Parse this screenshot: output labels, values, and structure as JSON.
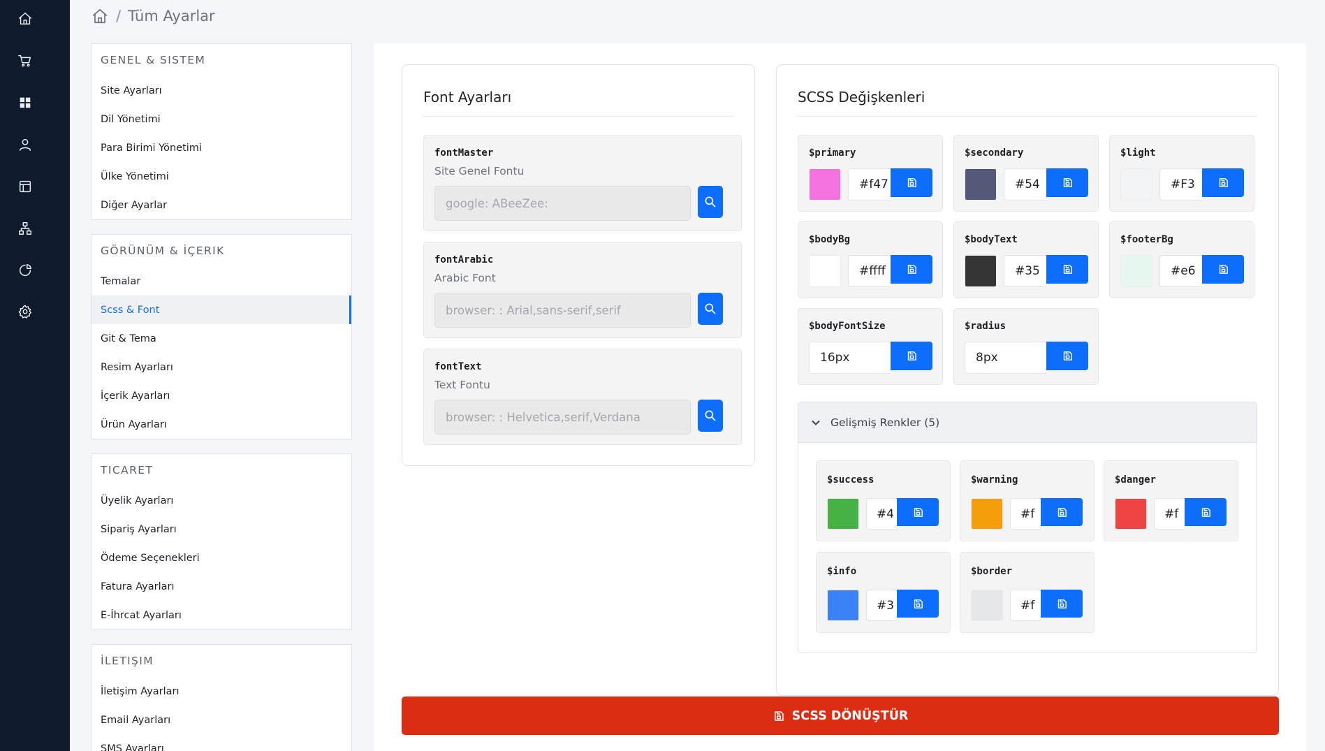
{
  "breadcrumb": {
    "title": "Tüm Ayarlar",
    "separator": "/"
  },
  "rail": {
    "icons": [
      "home-icon",
      "cart-icon",
      "grid-icon",
      "user-icon",
      "layout-icon",
      "sitemap-icon",
      "pie-chart-icon",
      "gear-icon"
    ]
  },
  "menu": {
    "groups": [
      {
        "title": "GENEL & SISTEM",
        "items": [
          "Site Ayarları",
          "Dil Yönetimi",
          "Para Birimi Yönetimi",
          "Ülke Yönetimi",
          "Diğer Ayarlar"
        ]
      },
      {
        "title": "GÖRÜNÜM & İÇERIK",
        "items": [
          "Temalar",
          "Scss & Font",
          "Git & Tema",
          "Resim Ayarları",
          "İçerik Ayarları",
          "Ürün Ayarları"
        ]
      },
      {
        "title": "TICARET",
        "items": [
          "Üyelik Ayarları",
          "Sipariş Ayarları",
          "Ödeme Seçenekleri",
          "Fatura Ayarları",
          "E-İhrcat Ayarları"
        ]
      },
      {
        "title": "İLETIŞIM",
        "items": [
          "İletişim Ayarları",
          "Email Ayarları",
          "SMS Ayarları"
        ]
      }
    ],
    "active_item": "Scss & Font"
  },
  "fonts": {
    "title": "Font Ayarları",
    "items": [
      {
        "key": "fontMaster",
        "label": "Site Genel Fontu",
        "placeholder": "google: ABeeZee:"
      },
      {
        "key": "fontArabic",
        "label": "Arabic Font",
        "placeholder": "browser: : Arial,sans-serif,serif"
      },
      {
        "key": "fontText",
        "label": "Text Fontu",
        "placeholder": "browser: : Helvetica,serif,Verdana"
      }
    ]
  },
  "scss": {
    "title": "SCSS Değişkenleri",
    "vars": [
      {
        "key": "$primary",
        "value": "#f47",
        "color": "#f472e0"
      },
      {
        "key": "$secondary",
        "value": "#54",
        "color": "#545878"
      },
      {
        "key": "$light",
        "value": "#F3",
        "color": "#f3f4f6"
      },
      {
        "key": "$bodyBg",
        "value": "#ffff",
        "color": "#ffffff"
      },
      {
        "key": "$bodyText",
        "value": "#35",
        "color": "#353535"
      },
      {
        "key": "$footerBg",
        "value": "#e6",
        "color": "#e6f7ef"
      }
    ],
    "sizes": [
      {
        "key": "$bodyFontSize",
        "value": "16px"
      },
      {
        "key": "$radius",
        "value": "8px"
      }
    ],
    "advanced": {
      "title": "Gelişmiş Renkler (5)",
      "vars": [
        {
          "key": "$success",
          "value": "#4",
          "color": "#46b145"
        },
        {
          "key": "$warning",
          "value": "#f",
          "color": "#f59e0b"
        },
        {
          "key": "$danger",
          "value": "#f",
          "color": "#ef4444"
        },
        {
          "key": "$info",
          "value": "#3",
          "color": "#3b82f6"
        },
        {
          "key": "$border",
          "value": "#f",
          "color": "#e5e7eb"
        }
      ]
    }
  },
  "convert_button": {
    "label": "SCSS DÖNÜŞTÜR"
  }
}
